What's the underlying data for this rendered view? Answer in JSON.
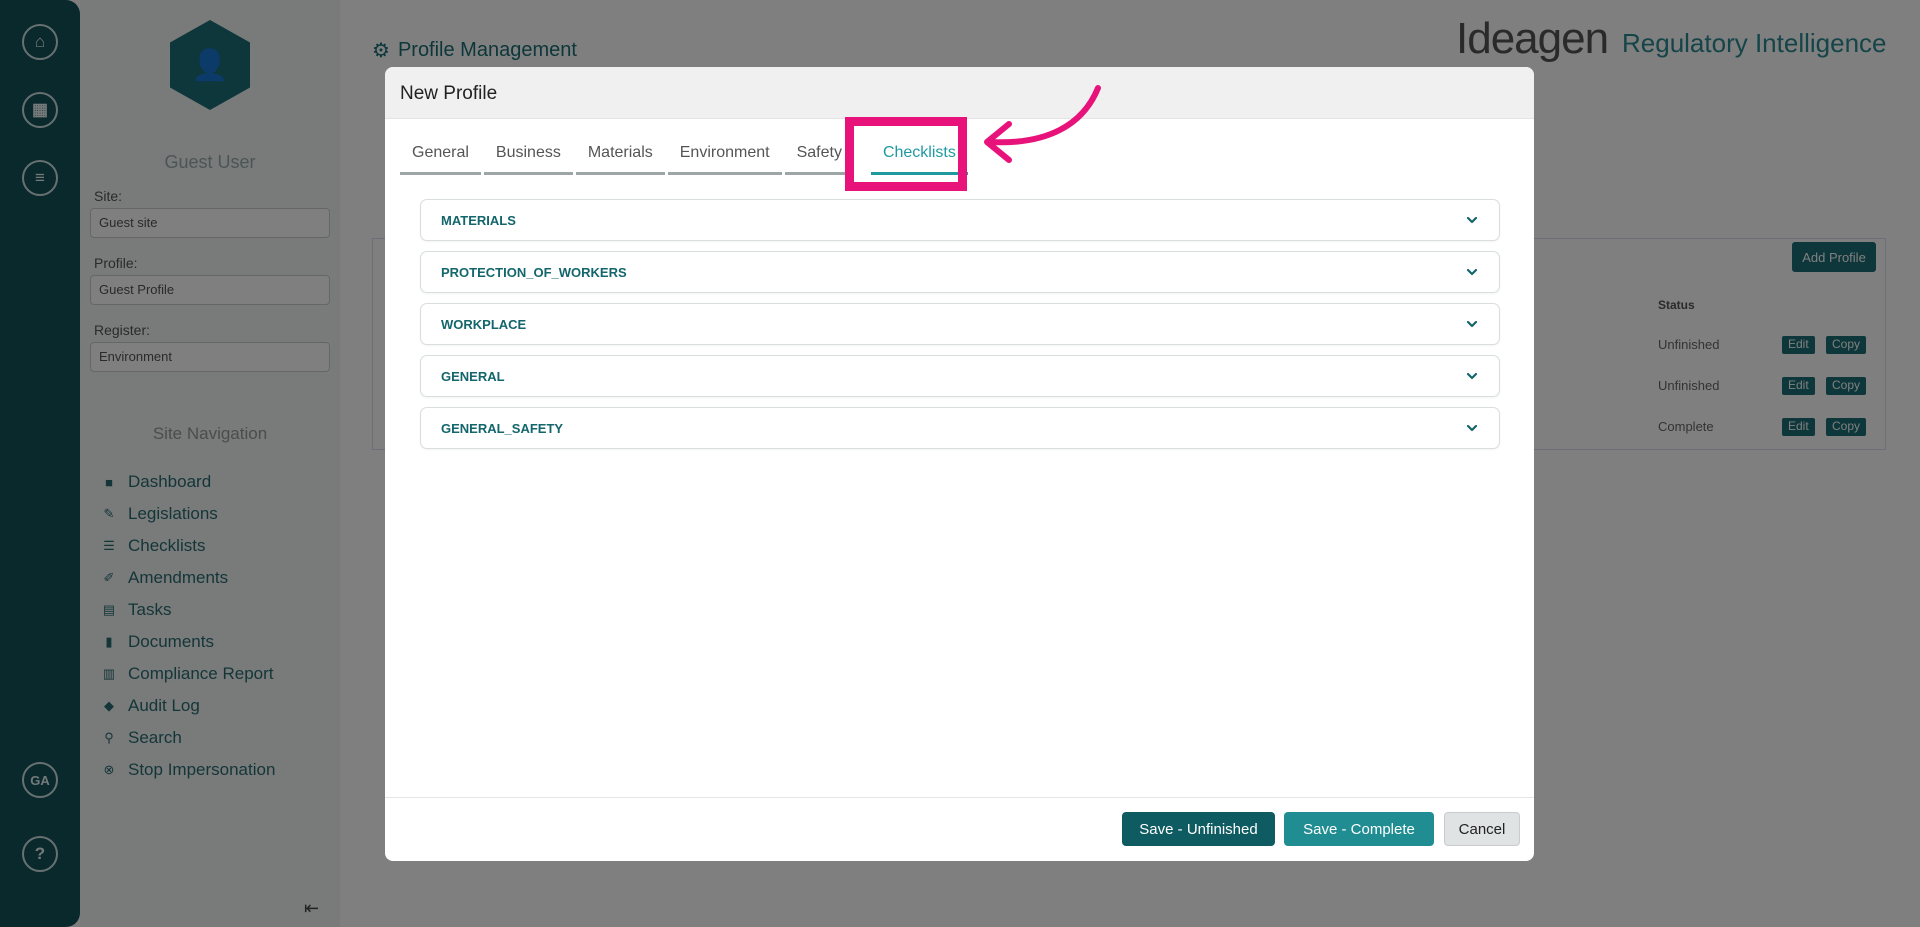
{
  "background": {
    "user_name": "Guest User",
    "site_label": "Site:",
    "site_value": "Guest site",
    "profile_label": "Profile:",
    "profile_value": "Guest Profile",
    "register_label": "Register:",
    "register_value": "Environment",
    "nav_title": "Site Navigation",
    "nav_items": [
      {
        "label": "Dashboard",
        "icon": "dashboard-icon"
      },
      {
        "label": "Legislations",
        "icon": "gavel-icon"
      },
      {
        "label": "Checklists",
        "icon": "list-icon"
      },
      {
        "label": "Amendments",
        "icon": "edit-icon"
      },
      {
        "label": "Tasks",
        "icon": "tasks-icon"
      },
      {
        "label": "Documents",
        "icon": "document-icon"
      },
      {
        "label": "Compliance Report",
        "icon": "chart-icon"
      },
      {
        "label": "Audit Log",
        "icon": "tag-icon"
      },
      {
        "label": "Search",
        "icon": "search-icon"
      },
      {
        "label": "Stop Impersonation",
        "icon": "stop-icon"
      }
    ],
    "rail_avatar": "GA",
    "rail_help": "?",
    "page_title": "Profile Management",
    "brand": "Ideagen",
    "brand_sub": "Regulatory Intelligence",
    "add_profile": "Add Profile",
    "status_header": "Status",
    "rows": [
      {
        "status": "Unfinished",
        "edit": "Edit",
        "copy": "Copy"
      },
      {
        "status": "Unfinished",
        "edit": "Edit",
        "copy": "Copy"
      },
      {
        "status": "Complete",
        "edit": "Edit",
        "copy": "Copy"
      }
    ]
  },
  "modal": {
    "title": "New Profile",
    "tabs": [
      "General",
      "Business",
      "Materials",
      "Environment",
      "Safety",
      "Checklists"
    ],
    "active_tab": "Checklists",
    "sections": [
      "MATERIALS",
      "PROTECTION_OF_WORKERS",
      "WORKPLACE",
      "GENERAL",
      "GENERAL_SAFETY"
    ],
    "buttons": {
      "save_unfinished": "Save - Unfinished",
      "save_complete": "Save - Complete",
      "cancel": "Cancel"
    }
  },
  "colors": {
    "accent": "#1f9aa0",
    "dark_teal": "#0e5b61",
    "highlight": "#e8137a"
  }
}
